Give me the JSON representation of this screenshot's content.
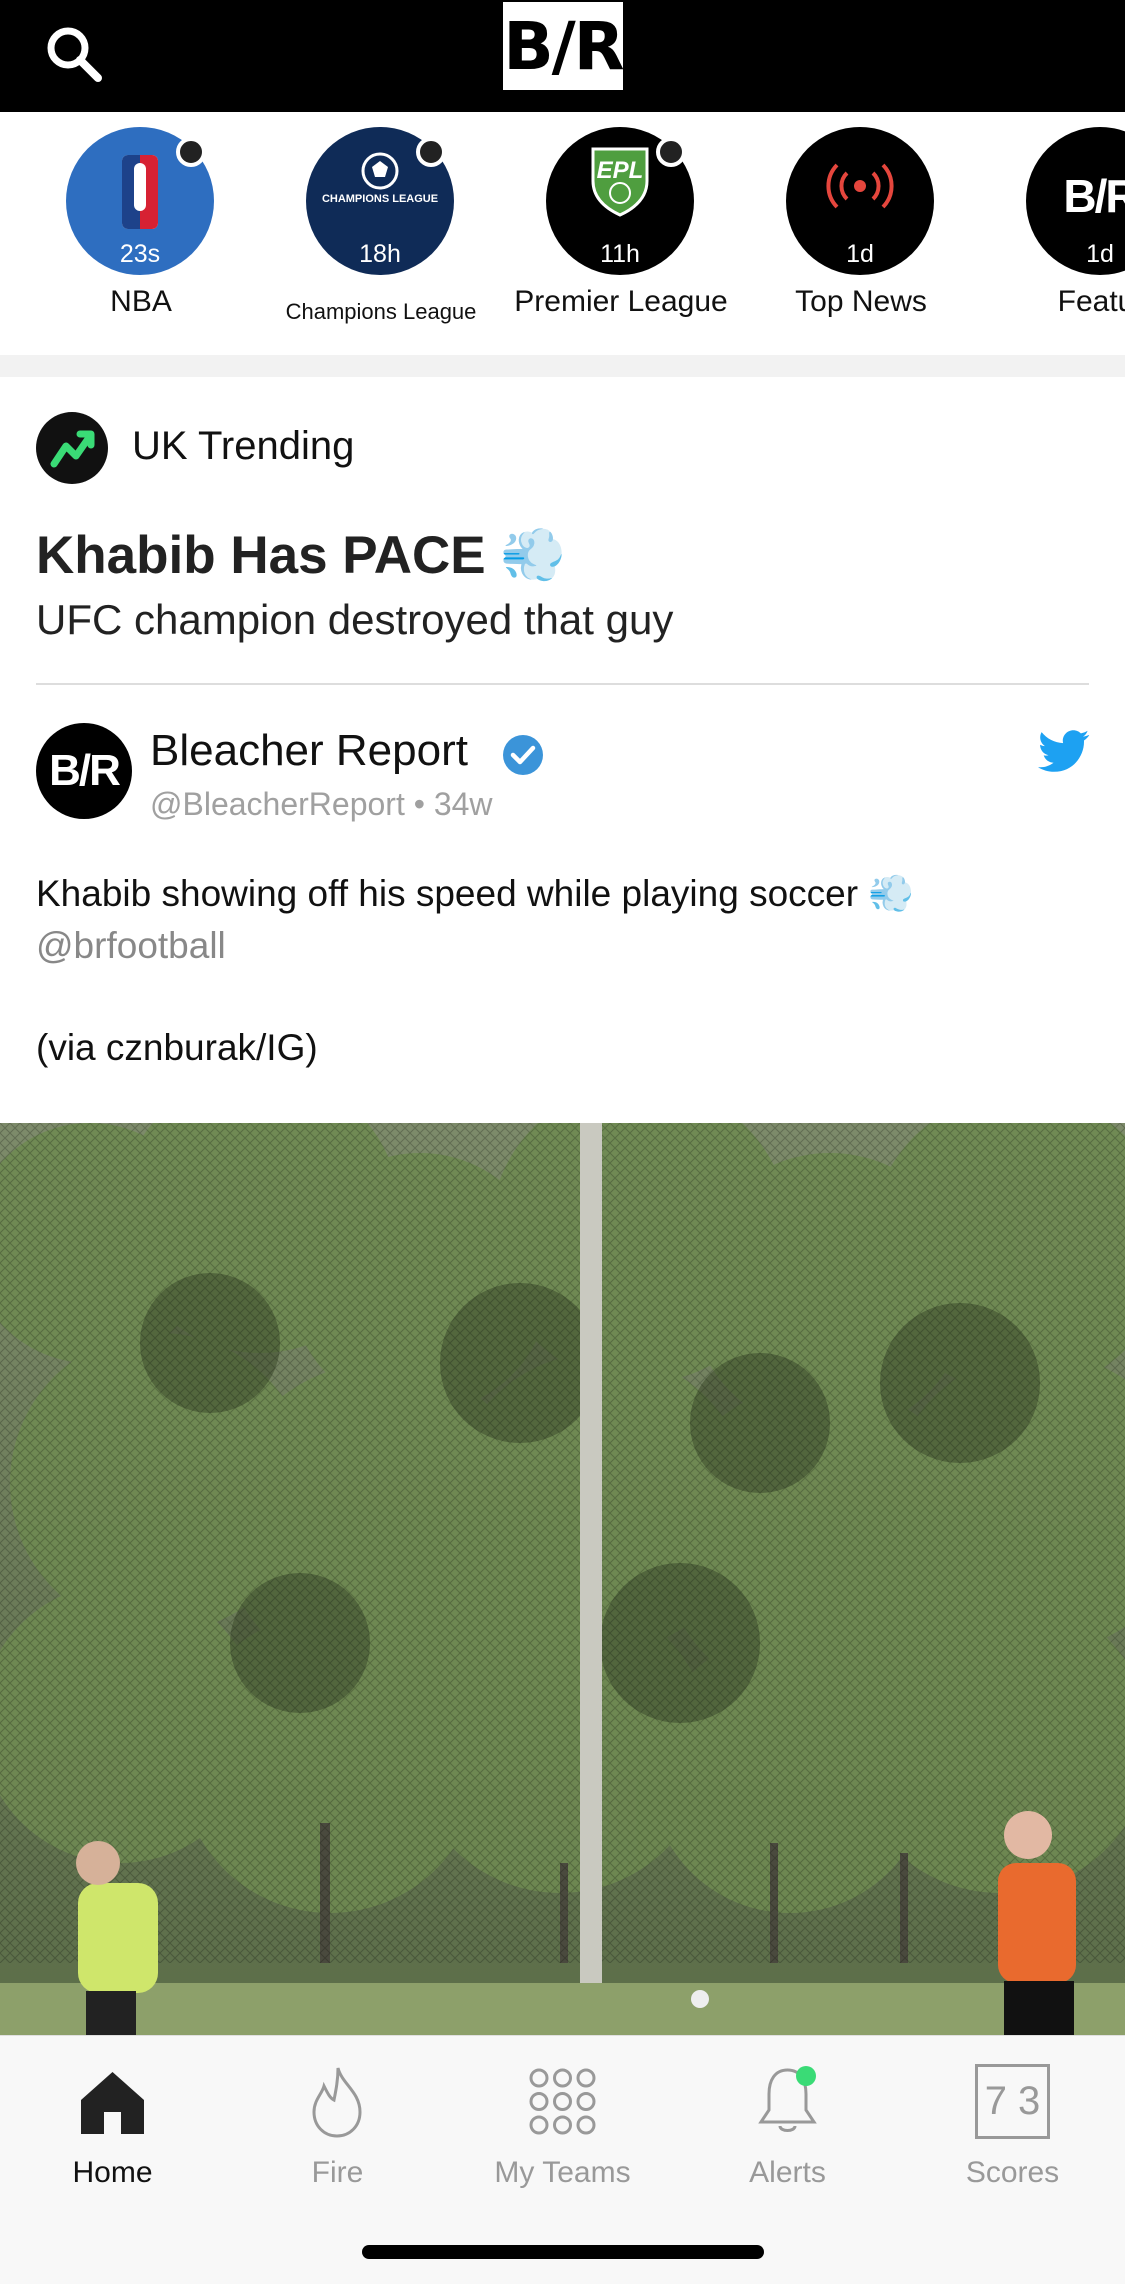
{
  "header": {
    "logo_text": "B/R",
    "icons": {
      "search": "search-icon"
    }
  },
  "streams": [
    {
      "id": "nba",
      "label": "NBA",
      "age": "23s",
      "bg": "#2e6ec0",
      "has_unread": true
    },
    {
      "id": "champions",
      "label": "Champions League",
      "age": "18h",
      "bg": "#0f2b57",
      "logo_text": "CHAMPIONS LEAGUE",
      "has_unread": true
    },
    {
      "id": "epl",
      "label": "Premier League",
      "age": "11h",
      "bg": "#000000",
      "logo_text": "EPL",
      "has_unread": true
    },
    {
      "id": "top-news",
      "label": "Top News",
      "age": "1d",
      "bg": "#000000",
      "has_unread": false
    },
    {
      "id": "featured",
      "label": "Featur",
      "age": "1d",
      "bg": "#000000",
      "logo_text": "B/R",
      "has_unread": false
    }
  ],
  "post": {
    "channel": "UK Trending",
    "headline": "Khabib Has PACE 💨",
    "subhead": "UFC champion destroyed that guy"
  },
  "tweet": {
    "avatar_text": "B/R",
    "author": "Bleacher Report",
    "handle": "@BleacherReport • 34w",
    "text": "Khabib showing off his speed while playing soccer 💨",
    "mention": "@brfootball",
    "via": "(via cznburak/IG)"
  },
  "tabs": [
    {
      "id": "home",
      "label": "Home",
      "icon": "home-icon",
      "active": true
    },
    {
      "id": "fire",
      "label": "Fire",
      "icon": "fire-icon",
      "active": false
    },
    {
      "id": "my-teams",
      "label": "My Teams",
      "icon": "grid-icon",
      "active": false
    },
    {
      "id": "alerts",
      "label": "Alerts",
      "icon": "bell-icon",
      "active": false,
      "has_badge": true
    },
    {
      "id": "scores",
      "label": "Scores",
      "icon": "scores-icon",
      "active": false,
      "score_digits": "7 3"
    }
  ],
  "colors": {
    "accent_blue": "#1da1f2",
    "verified_blue": "#3b94d9",
    "trending_green": "#3adb76",
    "alerts_badge": "#3adb76"
  }
}
